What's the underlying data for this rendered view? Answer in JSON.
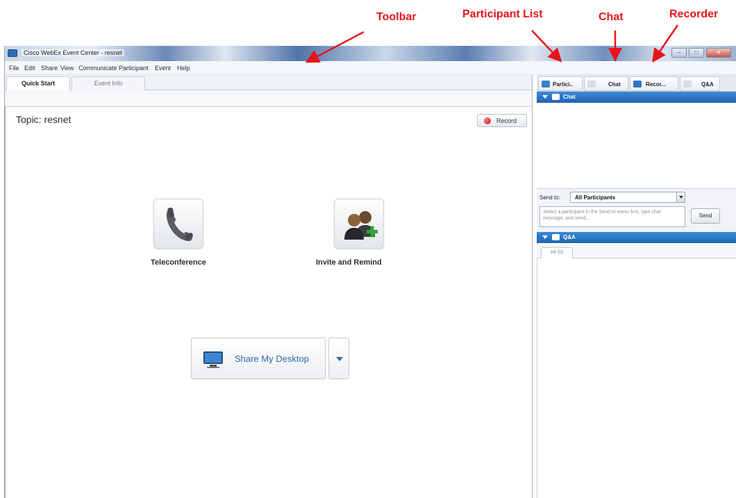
{
  "annotations": {
    "toolbar": "Toolbar",
    "participant_list": "Participant List",
    "chat": "Chat",
    "recorder": "Recorder"
  },
  "window": {
    "title": "Cisco WebEx Event Center - resnet"
  },
  "menu": [
    "File",
    "Edit",
    "Share",
    "View",
    "Communicate",
    "Participant",
    "Event",
    "Help"
  ],
  "left_tabs": [
    "Quick Start",
    "Event Info"
  ],
  "main": {
    "topic": "Topic:  resnet",
    "record_label": "Record",
    "teleconference_label": "Teleconference",
    "invite_label": "Invite and Remind",
    "share_label": "Share My Desktop"
  },
  "right_tabs": [
    "Partici..",
    "Chat",
    "Recor...",
    "Q&A"
  ],
  "chat_panel": {
    "header": "Chat",
    "send_to_label": "Send to:",
    "send_to_value": "All Participants",
    "input_placeholder": "Select a participant in the Send to menu first, type chat message, and send...",
    "send_label": "Send"
  },
  "qa_panel": {
    "header": "Q&A",
    "all_tab": "All (0)"
  },
  "colors": {
    "annotation": "#e8141a",
    "panel_header": "#1f64b0",
    "share_text": "#2c6aa8"
  },
  "icons": [
    "phone-icon",
    "invite-people-icon",
    "monitor-icon",
    "record-dot-icon",
    "chat-bubble-icon",
    "participants-icon",
    "recorder-icon",
    "qa-icon"
  ]
}
